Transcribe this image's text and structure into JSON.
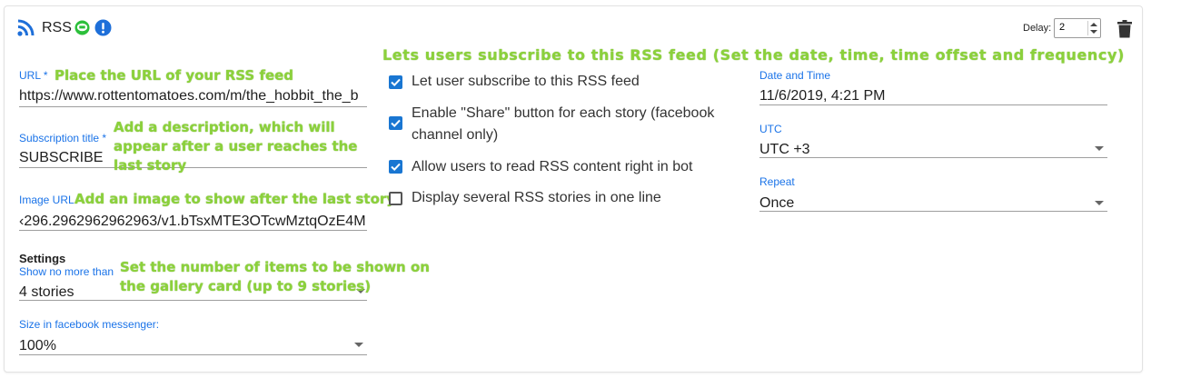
{
  "header": {
    "title": "RSS",
    "delay_label": "Delay:",
    "delay_value": "2"
  },
  "fields": {
    "url": {
      "label": "URL *",
      "value": "https://www.rottentomatoes.com/m/the_hobbit_the_b"
    },
    "subscription_title": {
      "label": "Subscription title *",
      "value": "SUBSCRIBE"
    },
    "image_url": {
      "label": "Image URL",
      "value": "‹296.2962962962963/v1.bTsxMTE3OTcwMztqOzE4M"
    }
  },
  "settings": {
    "title": "Settings",
    "show_no_more_than": {
      "label": "Show no more than",
      "value": "4 stories"
    },
    "size": {
      "label": "Size in facebook messenger:",
      "value": "100%"
    }
  },
  "options": [
    {
      "label": "Let user subscribe to this RSS feed",
      "checked": true
    },
    {
      "label": "Enable \"Share\" button for each story (facebook",
      "label2": "channel only)",
      "checked": true
    },
    {
      "label": "Allow users to read RSS content right in bot",
      "checked": true
    },
    {
      "label": "Display several RSS stories in one line",
      "checked": false
    }
  ],
  "schedule": {
    "date_time": {
      "label": "Date and Time",
      "value": "11/6/2019, 4:21 PM"
    },
    "utc": {
      "label": "UTC",
      "value": "UTC +3"
    },
    "repeat": {
      "label": "Repeat",
      "value": "Once"
    }
  },
  "annotations": {
    "subscribe": "Lets users subscribe to this RSS feed (Set the date, time, time offset and frequency)",
    "url": "Place the URL  of your RSS feed",
    "description_1": "Add a description, which will",
    "description_2": "appear after a user reaches the",
    "description_3": "last story",
    "image": "Add an image to show after the last story",
    "items_1": "Set the number of items to be shown on",
    "items_2": "the gallery card (up to 9 stories)"
  },
  "colors": {
    "accent": "#1a73e8",
    "checkbox": "#1976d2",
    "annotation": "#8bd13b",
    "rss_icon": "#1e6fd9",
    "line_icon": "#2bbf3a"
  }
}
